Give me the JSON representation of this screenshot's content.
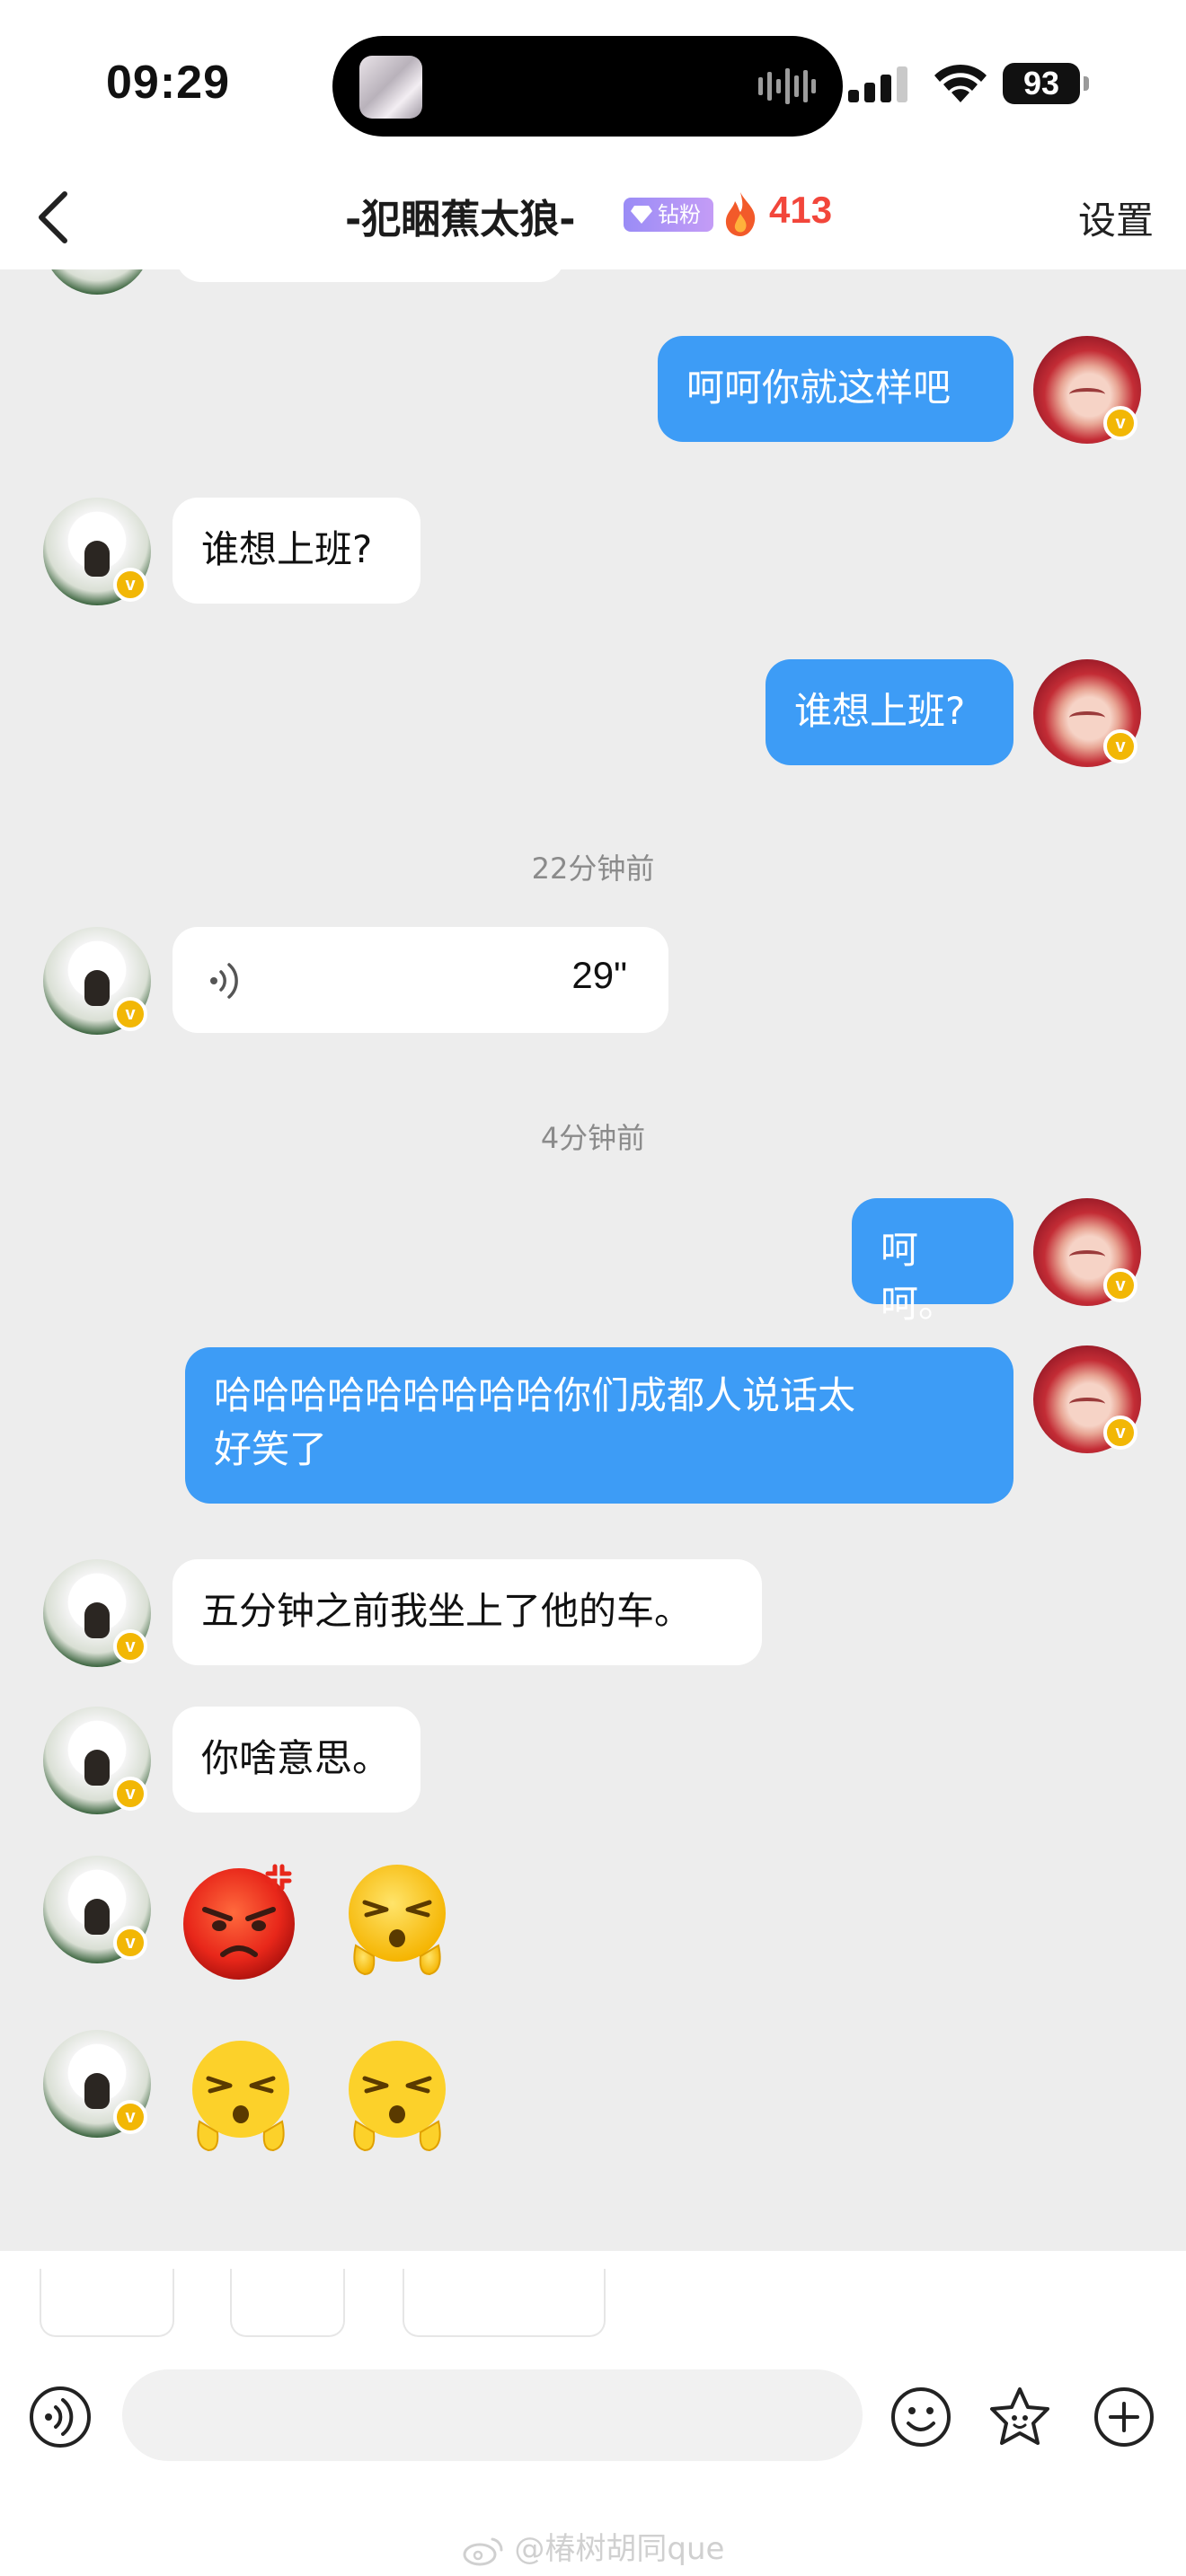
{
  "status_bar": {
    "time": "09:29",
    "battery": "93"
  },
  "header": {
    "title": "-犯睏蕉太狼-",
    "fan_badge": "钻粉2",
    "streak": "413",
    "settings_label": "设置"
  },
  "messages": [
    {
      "type": "text",
      "from": "me",
      "text": "呵呵你就这样吧"
    },
    {
      "type": "text",
      "from": "other",
      "text": "谁想上班?"
    },
    {
      "type": "text",
      "from": "me",
      "text": "谁想上班?"
    },
    {
      "type": "time",
      "text": "22分钟前"
    },
    {
      "type": "voice",
      "from": "other",
      "duration": "29\""
    },
    {
      "type": "time",
      "text": "4分钟前"
    },
    {
      "type": "text",
      "from": "me",
      "text": "呵呵。"
    },
    {
      "type": "text",
      "from": "me",
      "text_line1": "哈哈哈哈哈哈哈哈哈你们成都人说话太",
      "text_line2": "好笑了"
    },
    {
      "type": "text",
      "from": "other",
      "text": "五分钟之前我坐上了他的车。"
    },
    {
      "type": "text",
      "from": "other",
      "text": "你啥意思。"
    },
    {
      "type": "stickers",
      "from": "other",
      "stickers": [
        "angry-face",
        "snicker-face"
      ]
    },
    {
      "type": "stickers",
      "from": "other",
      "stickers": [
        "snicker-face",
        "snicker-face"
      ]
    }
  ],
  "verified_badge": "v",
  "watermark": "@椿树胡同que",
  "colors": {
    "outgoing_bubble": "#3d9cf6",
    "incoming_bubble": "#ffffff",
    "chat_background": "#ededed",
    "streak": "#f2463b",
    "fan_badge": "#a794f6"
  },
  "icons": [
    "back-chevron-icon",
    "diamond-icon",
    "flame-icon",
    "voice-input-icon",
    "emoji-icon",
    "sticker-icon",
    "plus-icon",
    "voice-wave-icon"
  ]
}
